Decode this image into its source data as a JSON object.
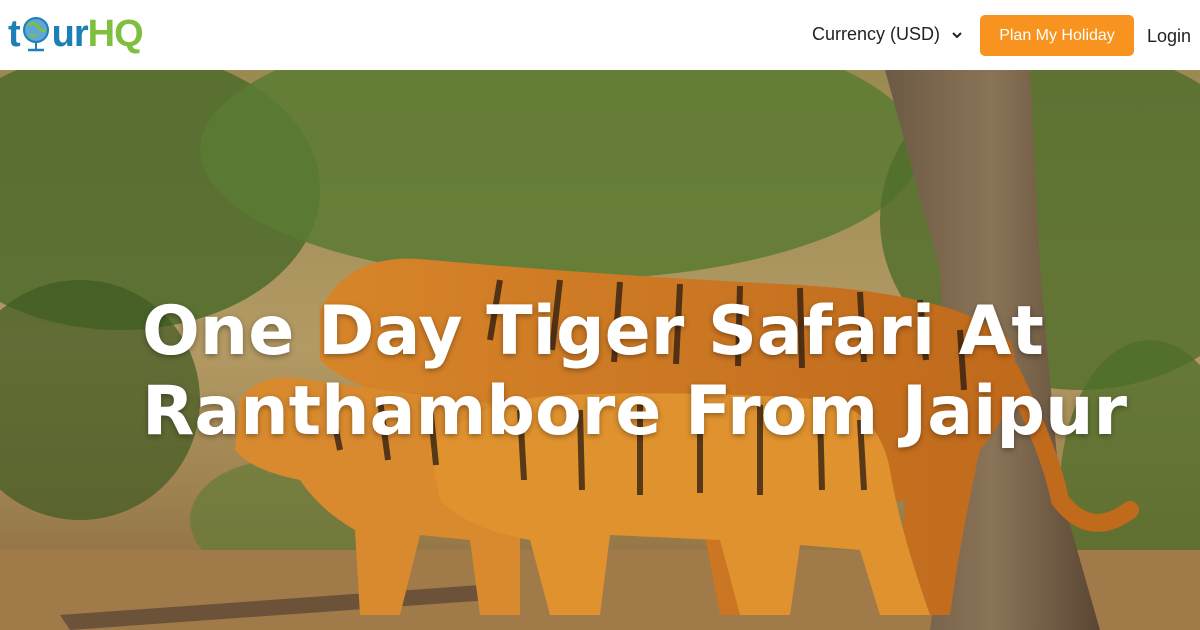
{
  "brand": {
    "logo_part1": "t",
    "logo_part2": "ur",
    "logo_part3": "HQ",
    "colors": {
      "blue": "#1c7fb5",
      "green": "#7fbf3f"
    }
  },
  "nav": {
    "currency_label": "Currency (USD)",
    "currency_icon": "chevron-down-icon",
    "plan_button": "Plan My Holiday",
    "plan_button_color": "#f7931e",
    "login": "Login"
  },
  "hero": {
    "title_line1": "One Day Tiger Safari At",
    "title_line2": "Ranthambore From Jaipur"
  }
}
